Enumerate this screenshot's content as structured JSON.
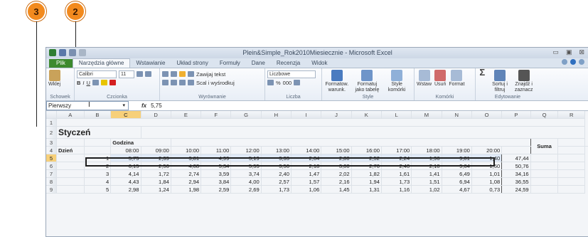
{
  "callouts": [
    "3",
    "2"
  ],
  "window": {
    "title": "Plein&Simple_Rok2010Miesiecznie - Microsoft Excel",
    "controls": [
      "▭",
      "▣",
      "⊠"
    ]
  },
  "tabs": [
    "Plik",
    "Narzędzia główne",
    "Wstawianie",
    "Układ strony",
    "Formuły",
    "Dane",
    "Recenzja",
    "Widok"
  ],
  "ribbon": {
    "paste": "Wklej",
    "schowek": "Schowek",
    "font_name": "Calibri",
    "font_size": "11",
    "czcionka": "Czcionka",
    "wrap": "Zawijaj tekst",
    "merge": "Scal i wyśrodkuj",
    "wyrownanie": "Wyrównanie",
    "number_format": "Liczbowe",
    "liczba": "Liczba",
    "cond_format": "Formatow. warunk.",
    "format_table": "Formatuj jako tabelę",
    "cell_styles": "Style komórki",
    "style": "Style",
    "insert": "Wstaw",
    "delete": "Usuń",
    "format": "Format",
    "komorki": "Komórki",
    "sort": "Sortuj i filtruj",
    "find": "Znajdź i zaznacz",
    "edytowanie": "Edytowanie"
  },
  "formula_bar": {
    "name_box": "Pierwszy",
    "fx": "fx",
    "value": "5,75"
  },
  "columns": [
    "",
    "A",
    "B",
    "C",
    "D",
    "E",
    "F",
    "G",
    "H",
    "I",
    "J",
    "K",
    "L",
    "M",
    "N",
    "O",
    "P",
    "Q",
    "R"
  ],
  "selected_column": "C",
  "selected_row": "5",
  "sheet": {
    "title": "Styczeń",
    "godzina": "Godzina",
    "dzien": "Dzień",
    "suma": "Suma",
    "hours": [
      "08:00",
      "09:00",
      "10:00",
      "11:00",
      "12:00",
      "13:00",
      "14:00",
      "15:00",
      "16:00",
      "17:00",
      "18:00",
      "19:00",
      "20:00"
    ],
    "rows": [
      {
        "row": "5",
        "day": "1",
        "vals": [
          "5,75",
          "2,39",
          "3,81",
          "4,99",
          "5,19",
          "3,33",
          "2,04",
          "2,80",
          "2,52",
          "2,24",
          "1,96",
          "9,01",
          "1,40"
        ],
        "sum": "47,44"
      },
      {
        "row": "6",
        "day": "2",
        "vals": [
          "6,15",
          "2,56",
          "4,08",
          "5,34",
          "5,55",
          "3,56",
          "2,18",
          "3,00",
          "2,70",
          "2,40",
          "2,10",
          "9,64",
          "1,50"
        ],
        "sum": "50,76"
      },
      {
        "row": "7",
        "day": "3",
        "vals": [
          "4,14",
          "1,72",
          "2,74",
          "3,59",
          "3,74",
          "2,40",
          "1,47",
          "2,02",
          "1,82",
          "1,61",
          "1,41",
          "6,49",
          "1,01"
        ],
        "sum": "34,16"
      },
      {
        "row": "8",
        "day": "4",
        "vals": [
          "4,43",
          "1,84",
          "2,94",
          "3,84",
          "4,00",
          "2,57",
          "1,57",
          "2,16",
          "1,94",
          "1,73",
          "1,51",
          "6,94",
          "1,08"
        ],
        "sum": "36,55"
      },
      {
        "row": "9",
        "day": "5",
        "vals": [
          "2,98",
          "1,24",
          "1,98",
          "2,59",
          "2,69",
          "1,73",
          "1,06",
          "1,45",
          "1,31",
          "1,16",
          "1,02",
          "4,67",
          "0,73"
        ],
        "sum": "24,59"
      }
    ]
  }
}
